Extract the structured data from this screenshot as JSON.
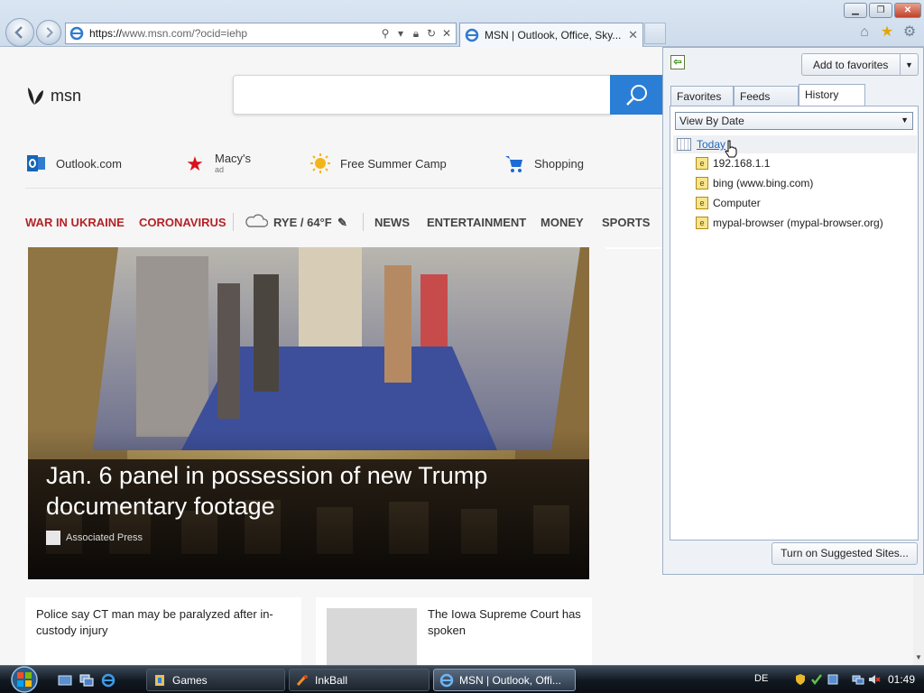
{
  "browser": {
    "url_scheme": "https://",
    "url_rest": "www.msn.com/?ocid=iehp",
    "tab_title": "MSN | Outlook, Office, Sky...",
    "window_buttons": {
      "minimize": "▁",
      "maximize": "❐",
      "close": "✕"
    }
  },
  "msn": {
    "logo_text": "msn",
    "quicklinks": [
      {
        "label": "Outlook.com",
        "sub": "",
        "icon": "outlook-icon"
      },
      {
        "label": "Macy's",
        "sub": "ad",
        "icon": "macys-star-icon"
      },
      {
        "label": "Free Summer Camp",
        "sub": "",
        "icon": "sun-icon"
      },
      {
        "label": "Shopping",
        "sub": "",
        "icon": "shopping-cart-icon"
      }
    ],
    "nav": {
      "war": "WAR IN UKRAINE",
      "corona": "CORONAVIRUS",
      "weather": "RYE / 64°F",
      "news": "NEWS",
      "entertainment": "ENTERTAINMENT",
      "money": "MONEY",
      "sports": "SPORTS"
    },
    "hero": {
      "title": "Jan. 6 panel in possession of new Trump documentary footage",
      "source": "Associated Press"
    },
    "cards": [
      {
        "title": "Police say CT man may be paralyzed after in-custody injury"
      },
      {
        "title": "The Iowa Supreme Court has spoken"
      }
    ]
  },
  "favorites_center": {
    "add_button": "Add to favorites",
    "tabs": [
      "Favorites",
      "Feeds",
      "History"
    ],
    "active_tab": "History",
    "view_by": "View By Date",
    "today": "Today",
    "history_items": [
      "192.168.1.1",
      "bing (www.bing.com)",
      "Computer",
      "mypal-browser (mypal-browser.org)"
    ],
    "suggested_button": "Turn on Suggested Sites..."
  },
  "taskbar": {
    "tasks": [
      "Games",
      "InkBall",
      "MSN | Outlook, Offi..."
    ],
    "language": "DE",
    "clock": "01:49"
  },
  "colors": {
    "accent_blue": "#2a7ed6",
    "nav_red": "#b42226",
    "link_blue": "#2466b8"
  }
}
